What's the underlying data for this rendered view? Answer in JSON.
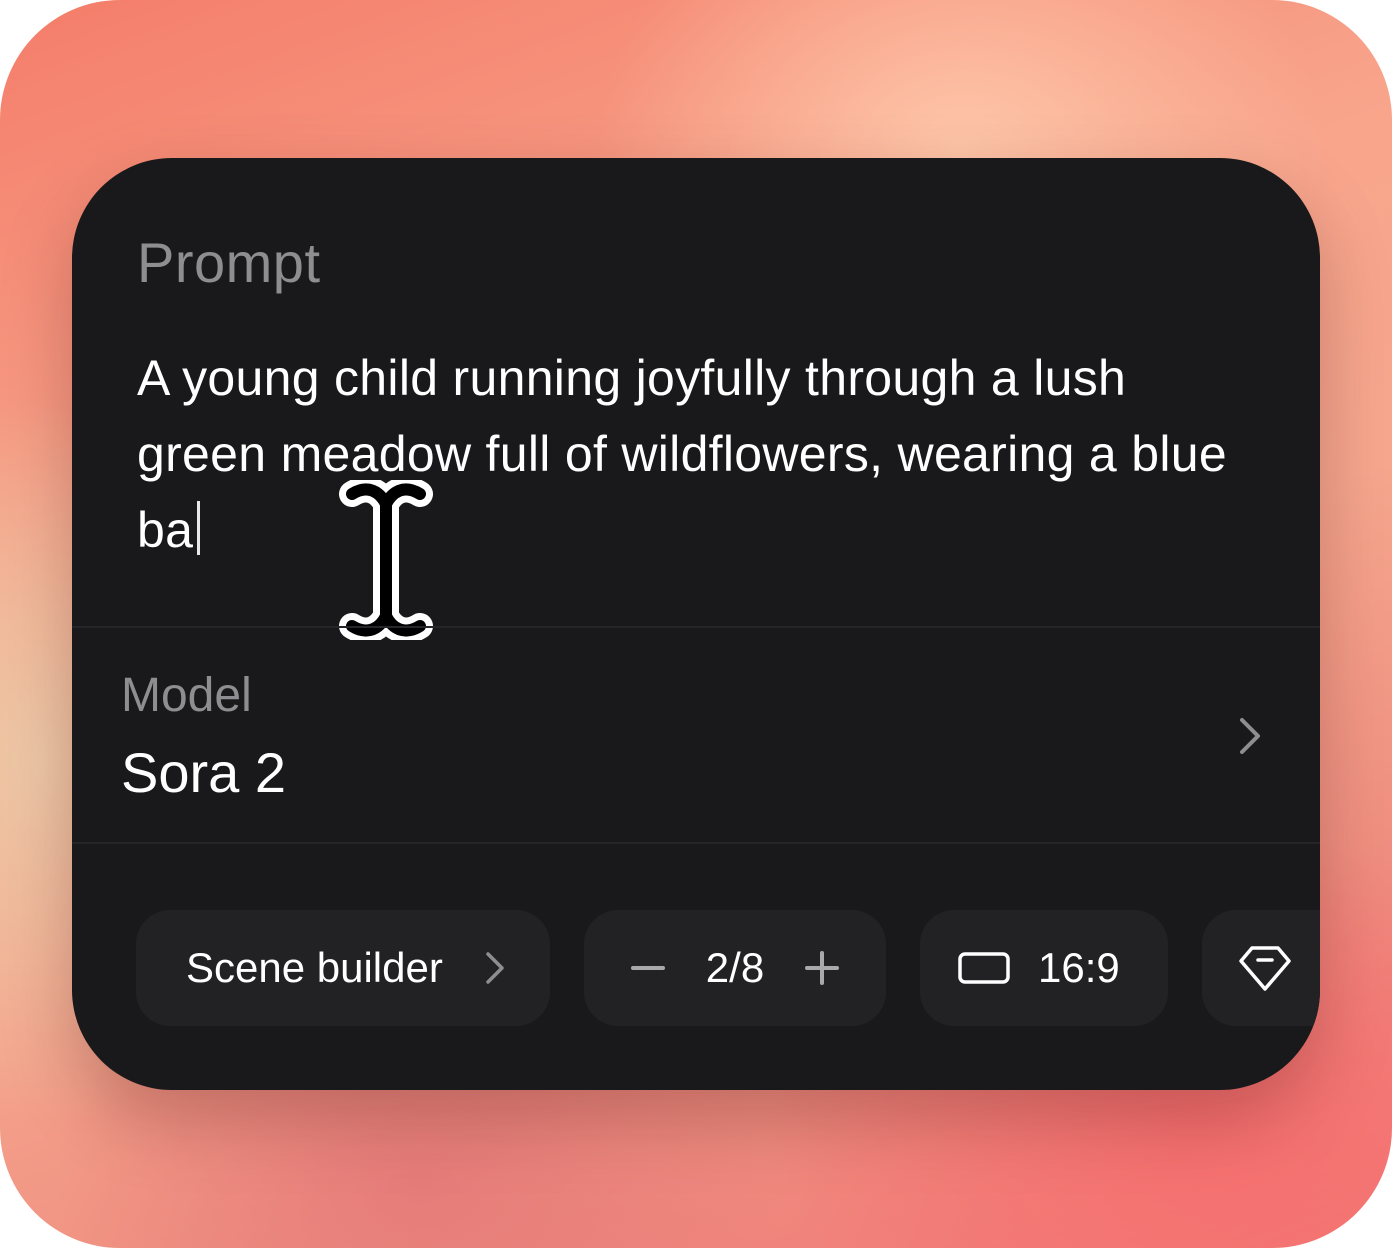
{
  "prompt": {
    "label": "Prompt",
    "text": "A young child running joyfully through a lush green meadow full of wildflowers, wearing a blue ba"
  },
  "model": {
    "label": "Model",
    "value": "Sora 2"
  },
  "controls": {
    "scene_builder_label": "Scene builder",
    "count_value": "2/8",
    "aspect_ratio_value": "16:9"
  },
  "colors": {
    "card_background": "#19191b",
    "chip_background": "#222225",
    "label_gray": "#8e8e92",
    "text_white": "#ffffff"
  },
  "icons": {
    "cursor": "text-cursor-ibeam-icon",
    "model_chevron": "chevron-right-icon",
    "scene_chevron": "chevron-right-icon",
    "decrease": "minus-icon",
    "increase": "plus-icon",
    "aspect": "aspect-ratio-rectangle-icon",
    "quality": "diamond-gem-icon"
  }
}
